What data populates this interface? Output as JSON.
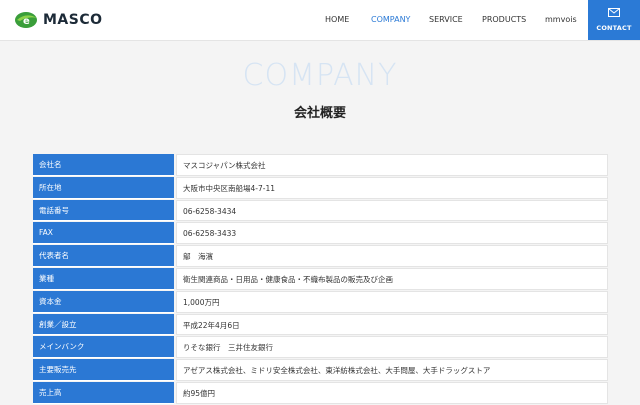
{
  "header": {
    "logo_text": "MASCO",
    "nav": [
      {
        "label": "HOME",
        "active": false
      },
      {
        "label": "COMPANY",
        "active": true
      },
      {
        "label": "SERVICE",
        "active": false
      },
      {
        "label": "PRODUCTS",
        "active": false
      },
      {
        "label": "mmvois",
        "active": false
      }
    ],
    "contact_label": "CONTACT",
    "contact_icon": "mail-icon",
    "accent_color": "#2b7ad6"
  },
  "page": {
    "heading_en": "COMPANY",
    "heading_jp": "会社概要"
  },
  "company_table": [
    {
      "label": "会社名",
      "value": "マスコジャパン株式会社"
    },
    {
      "label": "所在地",
      "value": "大阪市中央区南船場4-7-11"
    },
    {
      "label": "電話番号",
      "value": "06-6258-3434"
    },
    {
      "label": "FAX",
      "value": "06-6258-3433"
    },
    {
      "label": "代表者名",
      "value": "鄔　海濱"
    },
    {
      "label": "業種",
      "value": "衛生関連商品・日用品・健康食品・不織布製品の販売及び企画"
    },
    {
      "label": "資本金",
      "value": "1,000万円"
    },
    {
      "label": "創業／設立",
      "value": "平成22年4月6日"
    },
    {
      "label": "メインバンク",
      "value": "りそな銀行　三井住友銀行"
    },
    {
      "label": "主要販売先",
      "value": "アゼアス株式会社、ミドリ安全株式会社、東洋紡株式会社、大手問屋、大手ドラッグストア"
    },
    {
      "label": "売上高",
      "value": "約95億円"
    }
  ]
}
